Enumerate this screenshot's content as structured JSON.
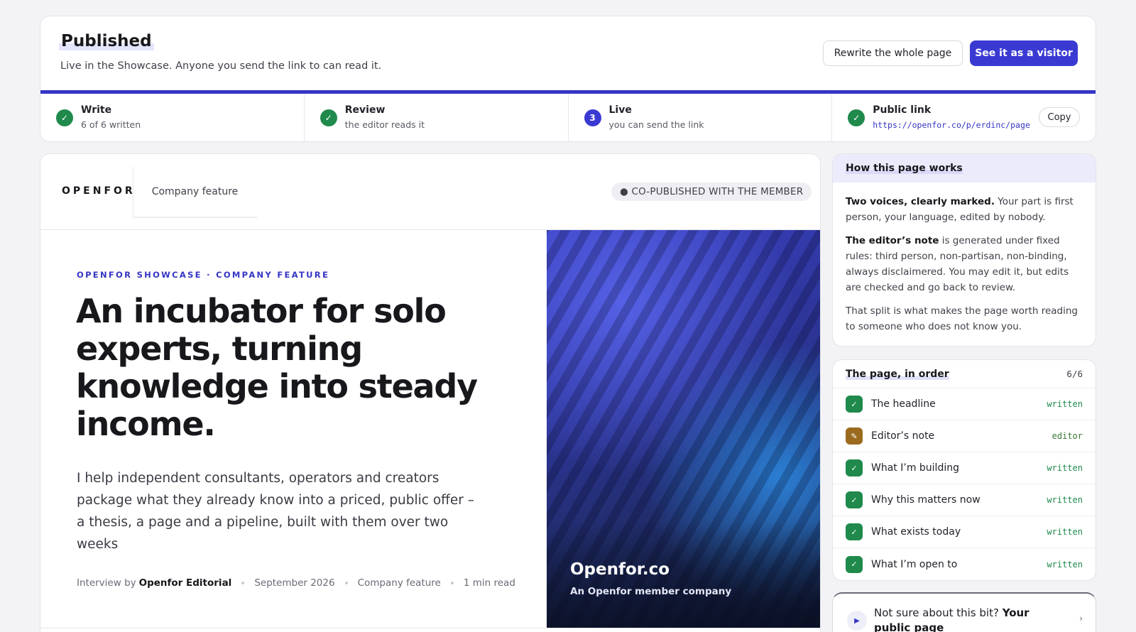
{
  "status": {
    "title": "Published",
    "subtitle": "Live in the Showcase. Anyone you send the link to can read it.",
    "rewrite_label": "Rewrite the whole page",
    "visitor_label": "See it as a visitor",
    "progress_fraction": 1.0,
    "steps": [
      {
        "title": "Write",
        "desc": "6 of 6 written",
        "state": "done"
      },
      {
        "title": "Review",
        "desc": "the editor reads it",
        "state": "done"
      },
      {
        "title": "Live",
        "desc": "you can send the link",
        "state": "current",
        "number": "3"
      },
      {
        "title": "Public link",
        "link": "https://openfor.co/p/erdinc/page",
        "state": "done",
        "copy_label": "Copy"
      }
    ]
  },
  "preview": {
    "brand": "OPENFOR",
    "tab_label": "Company feature",
    "copub_badge": "● CO-PUBLISHED WITH THE MEMBER",
    "eyebrow": "OPENFOR SHOWCASE · COMPANY FEATURE",
    "headline": "An incubator for solo experts, turning knowledge into steady income.",
    "lede": "I help independent consultants, operators and creators package what they already know into a priced, public offer – a thesis, a page and a pipeline, built with them over two weeks",
    "byline": {
      "prefix": "Interview by",
      "author": "Openfor Editorial",
      "date": "September 2026",
      "category": "Company feature",
      "read_time": "1 min read"
    },
    "hero": {
      "name": "Openfor.co",
      "sub": "An Openfor member company"
    }
  },
  "how": {
    "title": "How this page works",
    "p1_bold": "Two voices, clearly marked.",
    "p1_rest": " Your part is first person, your language, edited by nobody.",
    "p2_bold": "The editor’s note",
    "p2_rest": " is generated under fixed rules: third person, non-partisan, non-binding, always disclaimered. You may edit it, but edits are checked and go back to review.",
    "p3": "That split is what makes the page worth reading to someone who does not know you."
  },
  "order": {
    "title": "The page, in order",
    "count": "6/6",
    "rows": [
      {
        "label": "The headline",
        "status": "written",
        "kind": "written"
      },
      {
        "label": "Editor’s note",
        "status": "editor",
        "kind": "editor"
      },
      {
        "label": "What I’m building",
        "status": "written",
        "kind": "written"
      },
      {
        "label": "Why this matters now",
        "status": "written",
        "kind": "written"
      },
      {
        "label": "What exists today",
        "status": "written",
        "kind": "written"
      },
      {
        "label": "What I’m open to",
        "status": "written",
        "kind": "written"
      }
    ]
  },
  "help": {
    "prefix": "Not sure about this bit?",
    "bold": "Your public page"
  },
  "colors": {
    "accent": "#3a3ad3",
    "success": "#1f8a4c",
    "editor": "#9a6b1f"
  },
  "icons": {
    "done": "check-icon",
    "editor": "pencil-icon",
    "play": "play-icon",
    "chevron": "chevron-right-icon"
  }
}
